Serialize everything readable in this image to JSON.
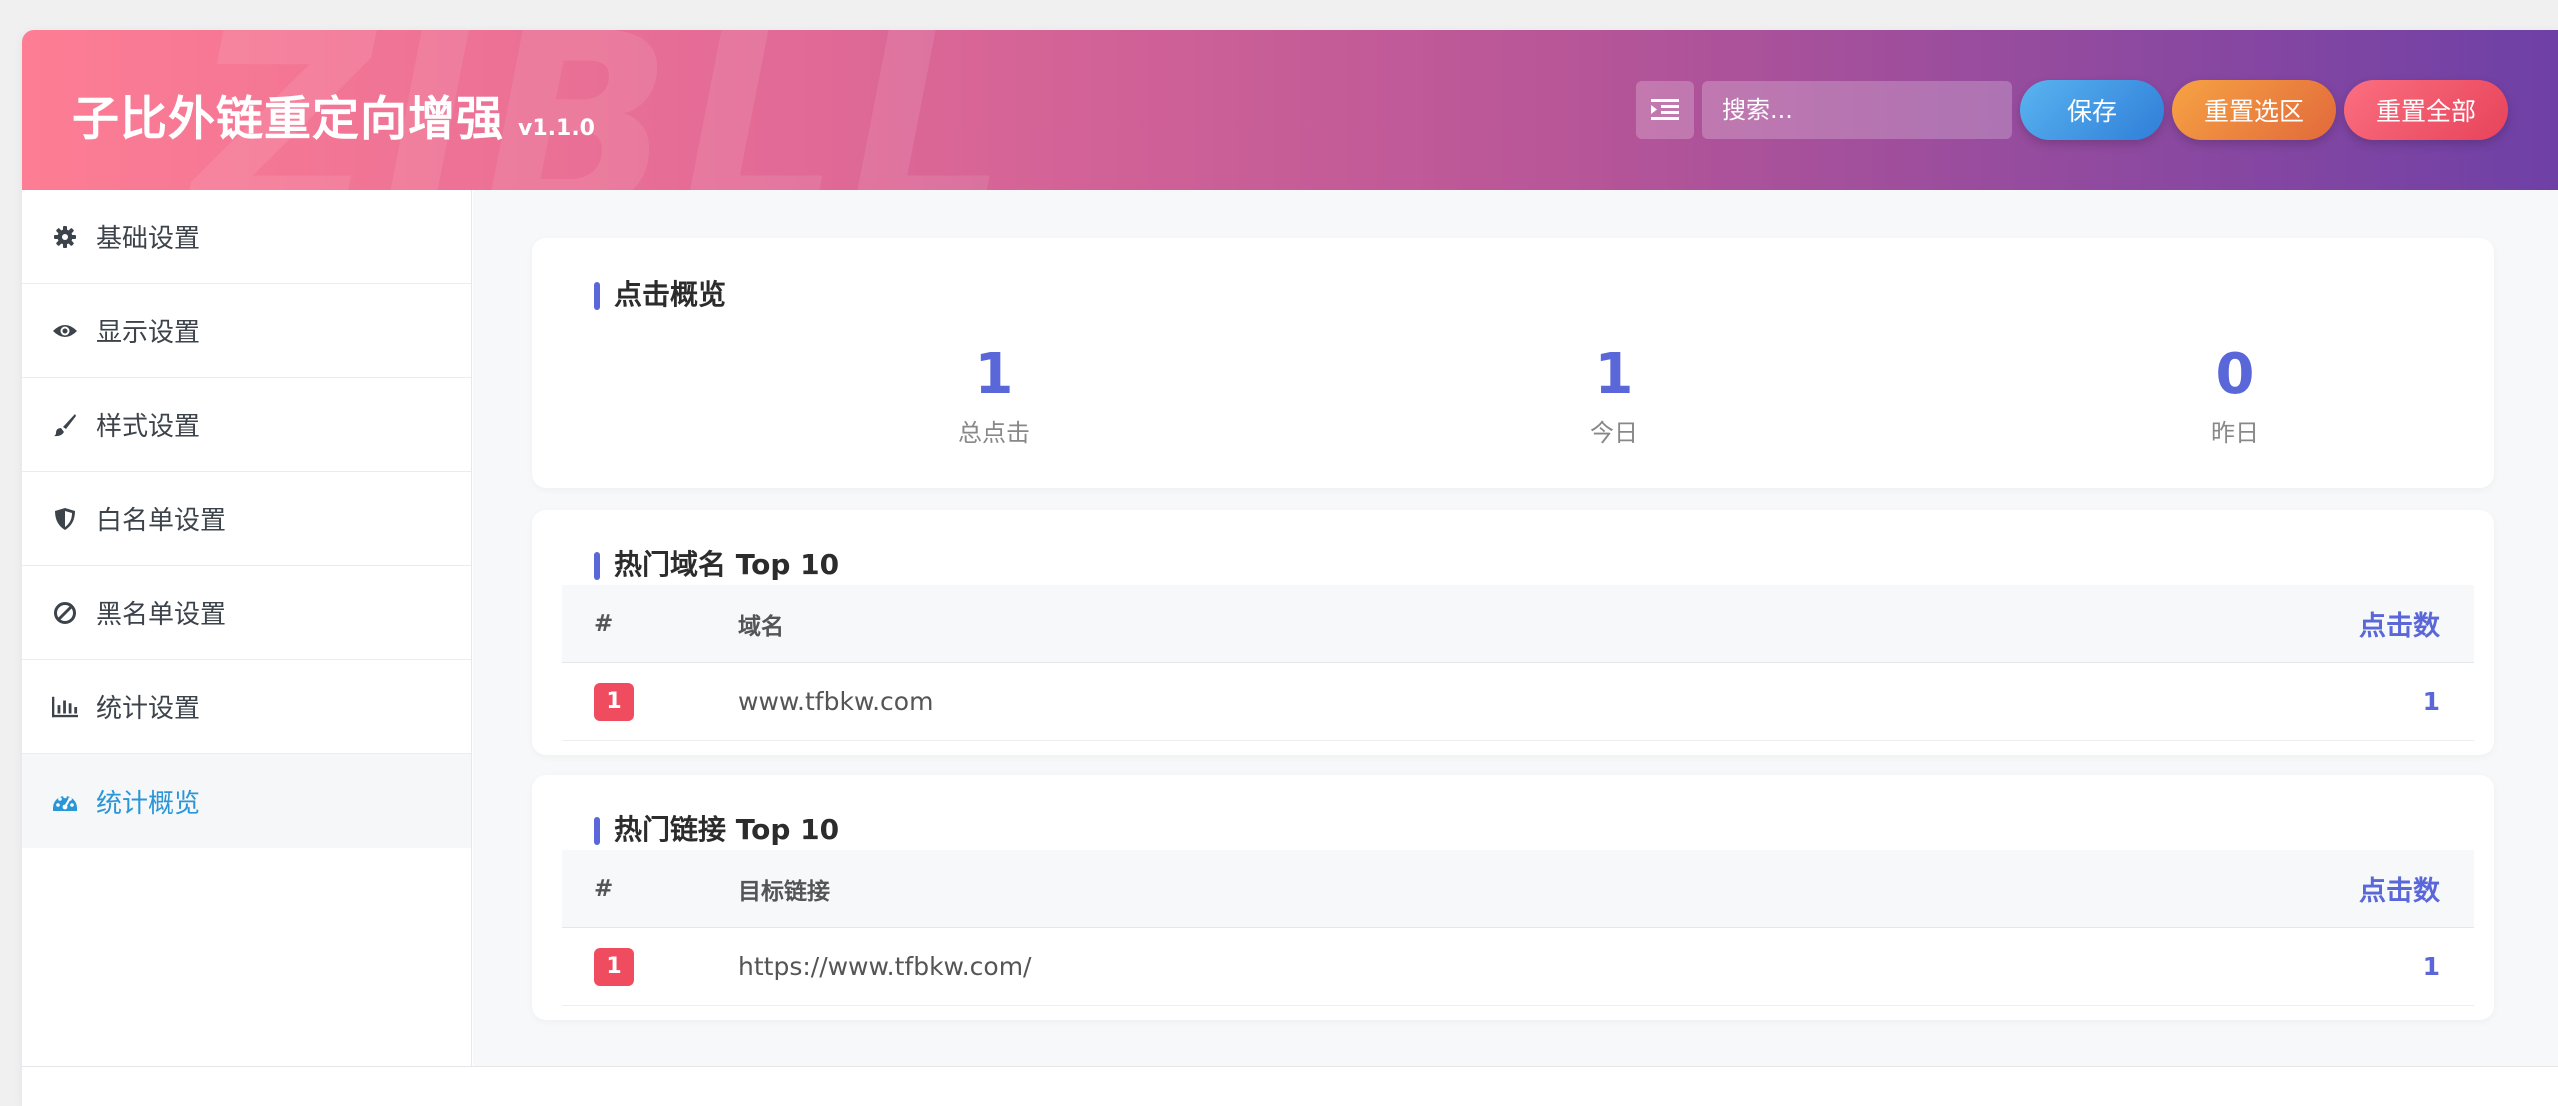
{
  "app": {
    "title": "子比外链重定向增强",
    "version": "v1.1.0",
    "watermark": "ZIBLL"
  },
  "header": {
    "search_placeholder": "搜索...",
    "save_label": "保存",
    "reset_selection_label": "重置选区",
    "reset_all_label": "重置全部"
  },
  "sidebar": {
    "items": [
      {
        "label": "基础设置",
        "icon": "gear-icon"
      },
      {
        "label": "显示设置",
        "icon": "eye-icon"
      },
      {
        "label": "样式设置",
        "icon": "brush-icon"
      },
      {
        "label": "白名单设置",
        "icon": "shield-icon"
      },
      {
        "label": "黑名单设置",
        "icon": "ban-icon"
      },
      {
        "label": "统计设置",
        "icon": "bar-chart-icon"
      },
      {
        "label": "统计概览",
        "icon": "dashboard-icon",
        "active": true
      }
    ]
  },
  "overview": {
    "title": "点击概览",
    "stats": [
      {
        "value": "1",
        "label": "总点击"
      },
      {
        "value": "1",
        "label": "今日"
      },
      {
        "value": "0",
        "label": "昨日"
      }
    ]
  },
  "top_domains": {
    "title": "热门域名 Top 10",
    "columns": [
      "#",
      "域名",
      "点击数"
    ],
    "rows": [
      {
        "rank": "1",
        "name": "www.tfbkw.com",
        "count": "1"
      }
    ]
  },
  "top_links": {
    "title": "热门链接 Top 10",
    "columns": [
      "#",
      "目标链接",
      "点击数"
    ],
    "rows": [
      {
        "rank": "1",
        "name": "https://www.tfbkw.com/",
        "count": "1"
      }
    ]
  },
  "colors": {
    "accent": "#5a67d8",
    "active_nav": "#2a96d8",
    "rank_badge": "#ef4d5f"
  }
}
